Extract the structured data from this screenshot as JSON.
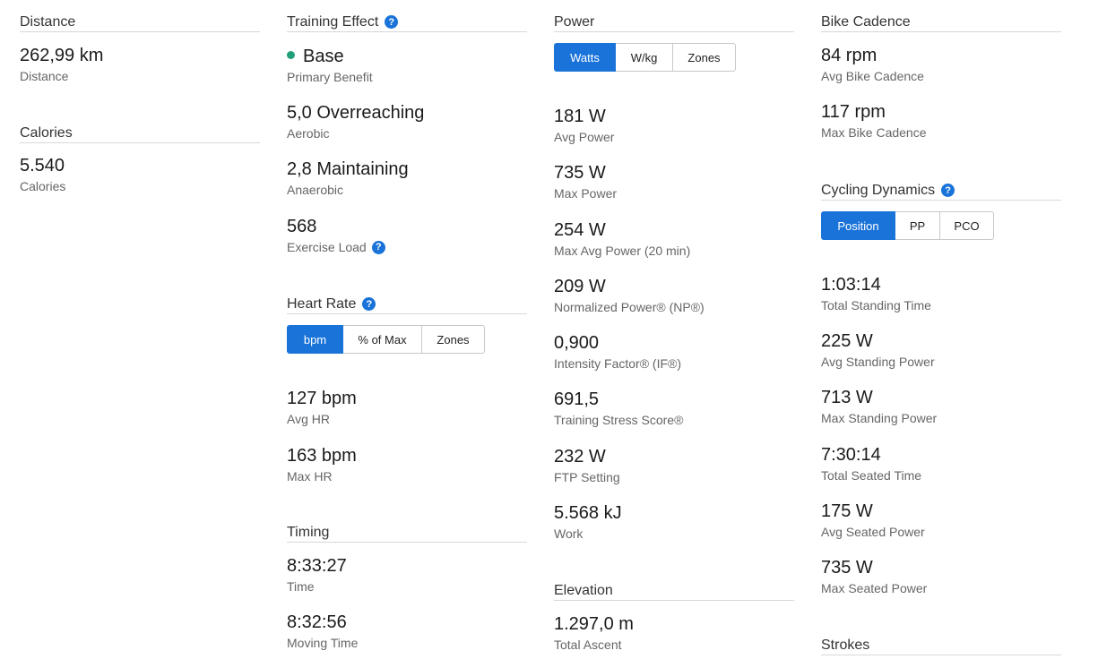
{
  "summary": {
    "distance_title": "Distance",
    "distance_value": "262,99 km",
    "distance_label": "Distance",
    "calories_title": "Calories",
    "calories_value": "5.540",
    "calories_label": "Calories"
  },
  "training_effect": {
    "title": "Training Effect",
    "primary_value": "Base",
    "primary_label": "Primary Benefit",
    "aerobic_value": "5,0 Overreaching",
    "aerobic_label": "Aerobic",
    "anaerobic_value": "2,8 Maintaining",
    "anaerobic_label": "Anaerobic",
    "load_value": "568",
    "load_label": "Exercise Load",
    "dot_color": "#21a07a"
  },
  "heart_rate": {
    "title": "Heart Rate",
    "tabs": [
      "bpm",
      "% of Max",
      "Zones"
    ],
    "avg_value": "127 bpm",
    "avg_label": "Avg HR",
    "max_value": "163 bpm",
    "max_label": "Max HR"
  },
  "timing": {
    "title": "Timing",
    "time_value": "8:33:27",
    "time_label": "Time",
    "moving_value": "8:32:56",
    "moving_label": "Moving Time"
  },
  "power": {
    "title": "Power",
    "tabs": [
      "Watts",
      "W/kg",
      "Zones"
    ],
    "stats": [
      {
        "value": "181 W",
        "label": "Avg Power"
      },
      {
        "value": "735 W",
        "label": "Max Power"
      },
      {
        "value": "254 W",
        "label": "Max Avg Power (20 min)"
      },
      {
        "value": "209 W",
        "label": "Normalized Power® (NP®)"
      },
      {
        "value": "0,900",
        "label": "Intensity Factor® (IF®)"
      },
      {
        "value": "691,5",
        "label": "Training Stress Score®"
      },
      {
        "value": "232 W",
        "label": "FTP Setting"
      },
      {
        "value": "5.568 kJ",
        "label": "Work"
      }
    ]
  },
  "elevation": {
    "title": "Elevation",
    "ascent_value": "1.297,0 m",
    "ascent_label": "Total Ascent"
  },
  "cadence": {
    "title": "Bike Cadence",
    "avg_value": "84 rpm",
    "avg_label": "Avg Bike Cadence",
    "max_value": "117 rpm",
    "max_label": "Max Bike Cadence"
  },
  "cycling_dynamics": {
    "title": "Cycling Dynamics",
    "tabs": [
      "Position",
      "PP",
      "PCO"
    ],
    "stats": [
      {
        "value": "1:03:14",
        "label": "Total Standing Time"
      },
      {
        "value": "225 W",
        "label": "Avg Standing Power"
      },
      {
        "value": "713 W",
        "label": "Max Standing Power"
      },
      {
        "value": "7:30:14",
        "label": "Total Seated Time"
      },
      {
        "value": "175 W",
        "label": "Avg Seated Power"
      },
      {
        "value": "735 W",
        "label": "Max Seated Power"
      }
    ]
  },
  "strokes": {
    "title": "Strokes"
  },
  "help_glyph": "?",
  "colors": {
    "accent": "#1a73d9",
    "benefit_dot": "#21a07a"
  }
}
